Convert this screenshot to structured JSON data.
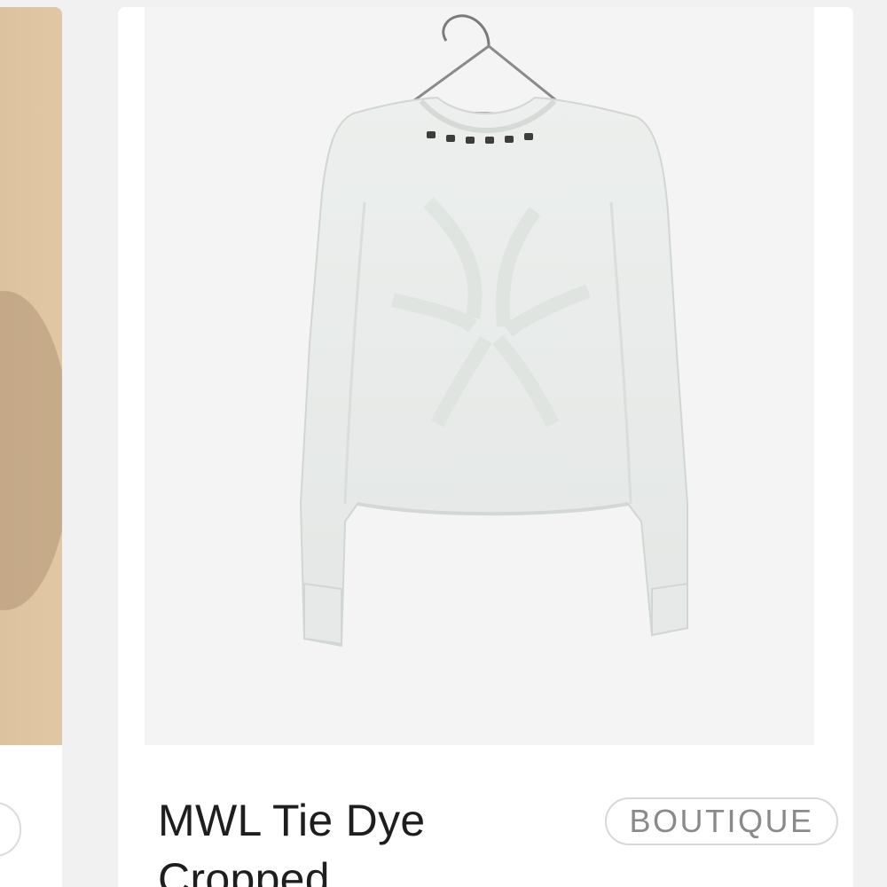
{
  "listing": {
    "product": {
      "title": "MWL Tie Dye Cropped",
      "badge": "BOUTIQUE",
      "image_icon": "sweater-on-hanger-image"
    },
    "neighbor_card": {
      "image_icon": "product-photo-partial"
    }
  },
  "colors": {
    "page_background": "#f1f1f1",
    "card_background": "#ffffff",
    "title_text": "#1e1e1e",
    "badge_text": "#8a8a8a",
    "badge_border": "#d8d8d8"
  }
}
